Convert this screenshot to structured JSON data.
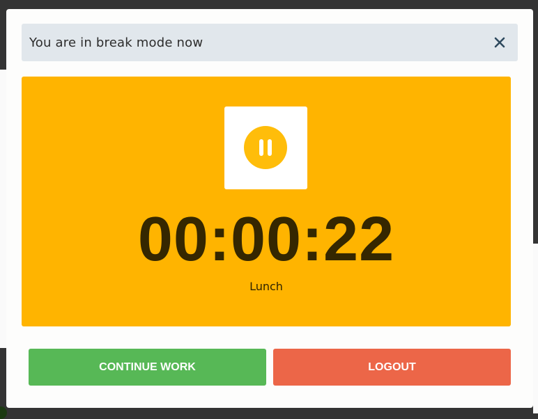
{
  "alert": {
    "message": "You are in break mode now",
    "close_icon": "close-icon"
  },
  "timer": {
    "state_icon": "pause-icon",
    "elapsed": "00:00:22",
    "break_type": "Lunch",
    "panel_color": "#ffb400"
  },
  "actions": {
    "continue_label": "CONTINUE WORK",
    "continue_color": "#57b856",
    "logout_label": "LOGOUT",
    "logout_color": "#ec6648"
  }
}
